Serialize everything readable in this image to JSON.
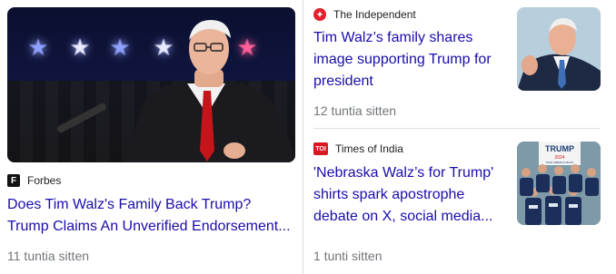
{
  "main_story": {
    "source": {
      "name": "Forbes",
      "icon": "forbes-f-icon",
      "icon_glyph": "F"
    },
    "headline_line1": "Does Tim Walz's Family Back Trump?",
    "headline_line2": "Trump Claims An Unverified Endorsement...",
    "time": "11 tuntia sitten"
  },
  "side_stories": [
    {
      "source": {
        "name": "The Independent",
        "icon": "independent-eagle-icon",
        "icon_glyph": "✦"
      },
      "headline_line1": "Tim Walz’s family shares",
      "headline_line2": "image supporting Trump for",
      "headline_line3": "president",
      "time": "12 tuntia sitten"
    },
    {
      "source": {
        "name": "Times of India",
        "icon": "toi-icon",
        "icon_glyph": "TOI"
      },
      "headline_line1": "'Nebraska Walz’s for Trump'",
      "headline_line2": "shirts spark apostrophe",
      "headline_line3": "debate on X, social media...",
      "time": "1 tunti sitten"
    }
  ],
  "thumb2_sign": {
    "line1": "TRUMP",
    "line2": "2024",
    "line3": "TAKE AMERICA BACK"
  },
  "colors": {
    "link": "#1a0dab",
    "meta": "#70757a",
    "divider": "#dadce0",
    "independent_red": "#e61e2b",
    "toi_red": "#d71921"
  }
}
